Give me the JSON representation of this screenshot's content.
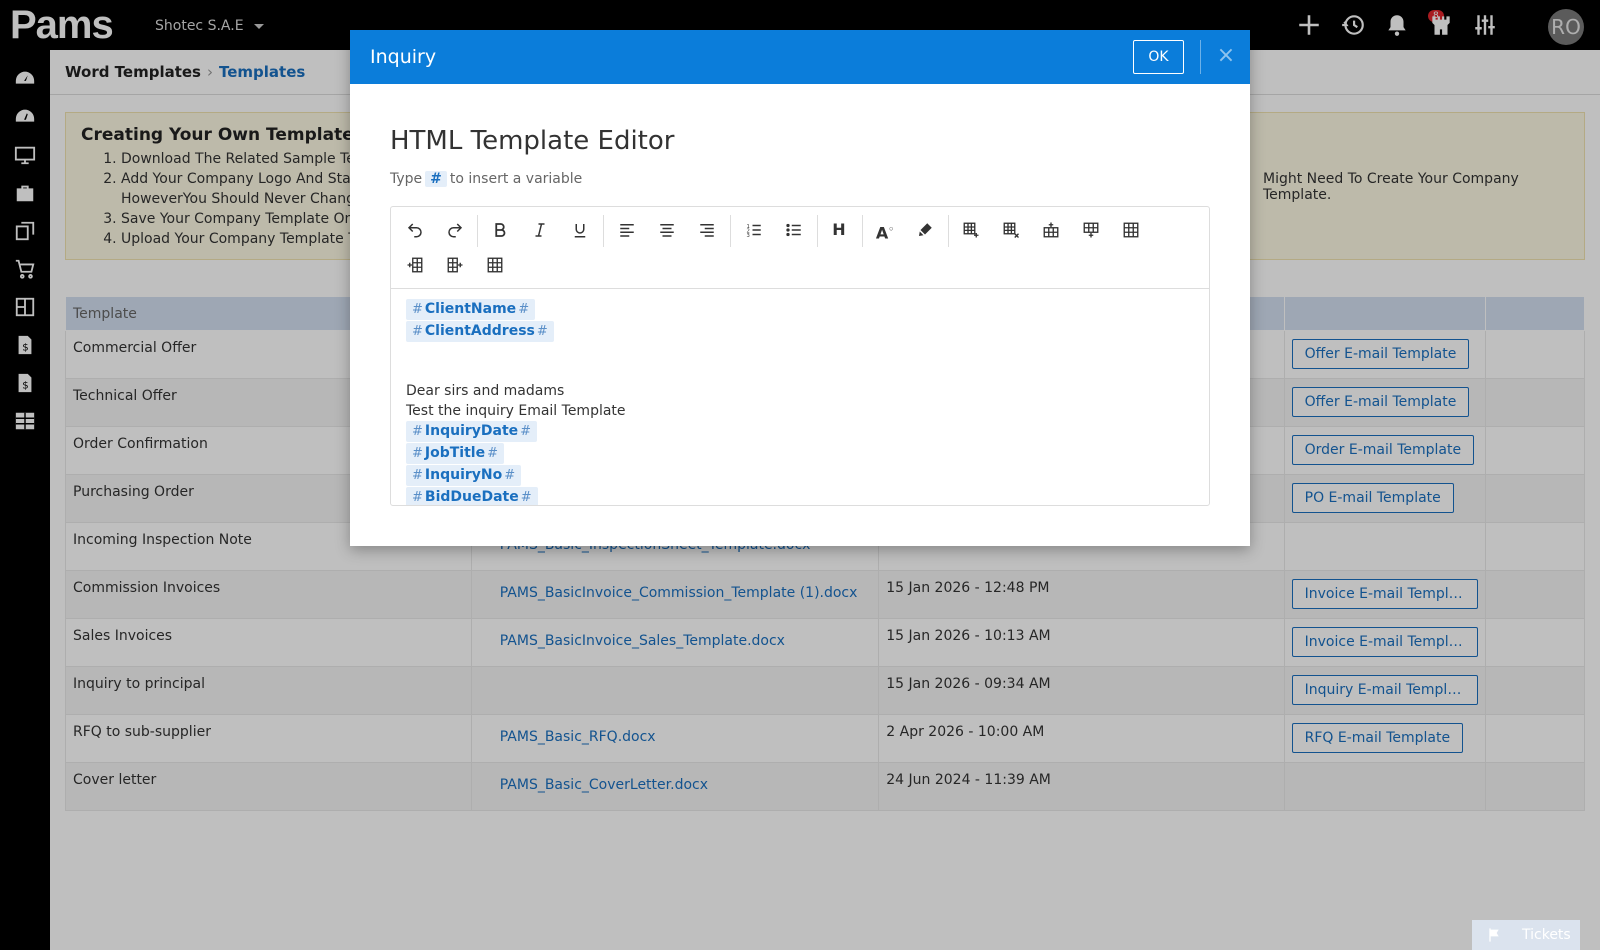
{
  "topbar": {
    "logo": "Pams",
    "company": "Shotec S.A.E",
    "notification_count": "8",
    "avatar_initials": "RO",
    "icons": [
      "plus-icon",
      "history-icon",
      "bell-icon",
      "castle-icon",
      "sliders-icon"
    ]
  },
  "sidebar": {
    "icons": [
      "dashboard-icon",
      "speedometer-icon",
      "monitor-icon",
      "briefcase-icon",
      "documents-icon",
      "cart-icon",
      "products-icon",
      "invoice-icon",
      "invoice-alt-icon",
      "reports-icon"
    ]
  },
  "breadcrumb": {
    "parent": "Word Templates",
    "current": "Templates"
  },
  "info": {
    "title": "Creating Your Own Template Fil",
    "steps": [
      "Download The Related Sample Ten",
      "Add Your Company Logo And Start",
      "Save Your Company Template On Y",
      "Upload Your Company Template To"
    ],
    "step2_cont": "HoweverYou Should Never Change",
    "right_text": "Might Need To Create Your Company Template."
  },
  "table": {
    "headers": [
      "Template",
      "",
      "",
      "",
      ""
    ],
    "rows": [
      {
        "name": "Commercial Offer",
        "file": "",
        "date": "",
        "button": "Offer E-mail Template"
      },
      {
        "name": "Technical Offer",
        "file": "",
        "date": "",
        "button": "Offer E-mail Template"
      },
      {
        "name": "Order Confirmation",
        "file": "",
        "date": "",
        "button": "Order E-mail Template"
      },
      {
        "name": "Purchasing Order",
        "file": "",
        "date": "",
        "button": "PO E-mail Template"
      },
      {
        "name": "Incoming Inspection Note",
        "file": "PAMS_Basic_InspectionSheet_Template.docx",
        "date": "",
        "button": ""
      },
      {
        "name": "Commission Invoices",
        "file": "PAMS_BasicInvoice_Commission_Template (1).docx",
        "date": "15 Jan 2026 - 12:48 PM",
        "button": "Invoice E-mail Template"
      },
      {
        "name": "Sales Invoices",
        "file": "PAMS_BasicInvoice_Sales_Template.docx",
        "date": "15 Jan 2026 - 10:13 AM",
        "button": "Invoice E-mail Template"
      },
      {
        "name": "Inquiry to principal",
        "file": "",
        "date": "15 Jan 2026 - 09:34 AM",
        "button": "Inquiry E-mail Templa..."
      },
      {
        "name": "RFQ to sub-supplier",
        "file": "PAMS_Basic_RFQ.docx",
        "date": "2 Apr 2026 - 10:00 AM",
        "button": "RFQ E-mail Template"
      },
      {
        "name": "Cover letter",
        "file": "PAMS_Basic_CoverLetter.docx",
        "date": "24 Jun 2024 - 11:39 AM",
        "button": ""
      }
    ]
  },
  "modal": {
    "title": "Inquiry",
    "ok_label": "OK",
    "close_label": "×",
    "editor_title": "HTML Template Editor",
    "hint_prefix": "Type",
    "hint_hash": "#",
    "hint_suffix": "to insert a variable",
    "content": {
      "var_client_name": "ClientName",
      "var_client_address": "ClientAddress",
      "line1": "Dear sirs and madams",
      "line2": "Test the inquiry Email Template",
      "var_inquiry_date": "InquiryDate",
      "var_job_title": "JobTitle",
      "var_inquiry_no": "InquiryNo",
      "var_bid_due_date": "BidDueDate"
    },
    "toolbar": {
      "heading_label": "H",
      "font_color_label": "A"
    }
  },
  "tickets": {
    "label": "Tickets"
  }
}
